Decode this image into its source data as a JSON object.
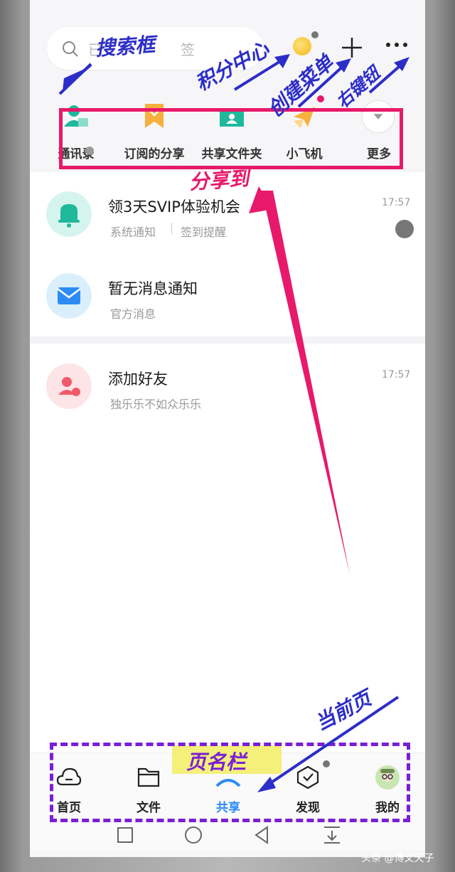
{
  "search": {
    "placeholder_start": "已",
    "placeholder_end": "签"
  },
  "actions": [
    {
      "label": "通讯录",
      "icon": "contacts-icon"
    },
    {
      "label": "订阅的分享",
      "icon": "bookmark-icon"
    },
    {
      "label": "共享文件夹",
      "icon": "shared-folder-icon"
    },
    {
      "label": "小飞机",
      "icon": "paper-plane-icon"
    },
    {
      "label": "更多",
      "icon": "more-chevron-icon"
    }
  ],
  "messages": [
    {
      "title": "领3天SVIP体验机会",
      "subtitle_a": "系统通知",
      "subtitle_b": "签到提醒",
      "time": "17:57",
      "icon": "bell-icon"
    },
    {
      "title": "暂无消息通知",
      "subtitle_a": "官方消息",
      "icon": "envelope-icon"
    },
    {
      "title": "添加好友",
      "subtitle_a": "独乐乐不如众乐乐",
      "time": "17:57",
      "icon": "add-friend-icon"
    }
  ],
  "tabs": [
    {
      "label": "首页",
      "icon": "cloud-icon"
    },
    {
      "label": "文件",
      "icon": "folder-icon"
    },
    {
      "label": "共享",
      "icon": "share-icon",
      "active": true
    },
    {
      "label": "发现",
      "icon": "discover-icon"
    },
    {
      "label": "我的",
      "icon": "avatar-icon"
    }
  ],
  "annotations": {
    "search_box": "搜索框",
    "points_center": "积分中心",
    "create_menu": "创建菜单",
    "right_button": "右键钮",
    "share_to": "分享到",
    "current_page": "当前页",
    "page_name_bar": "页名栏"
  },
  "watermark": "头条 @博文天子",
  "colors": {
    "accent": "#2c8cf4",
    "annotation_blue": "#2d2dc9",
    "annotation_pink": "#e8196a",
    "annotation_purple": "#7a1fd6"
  }
}
